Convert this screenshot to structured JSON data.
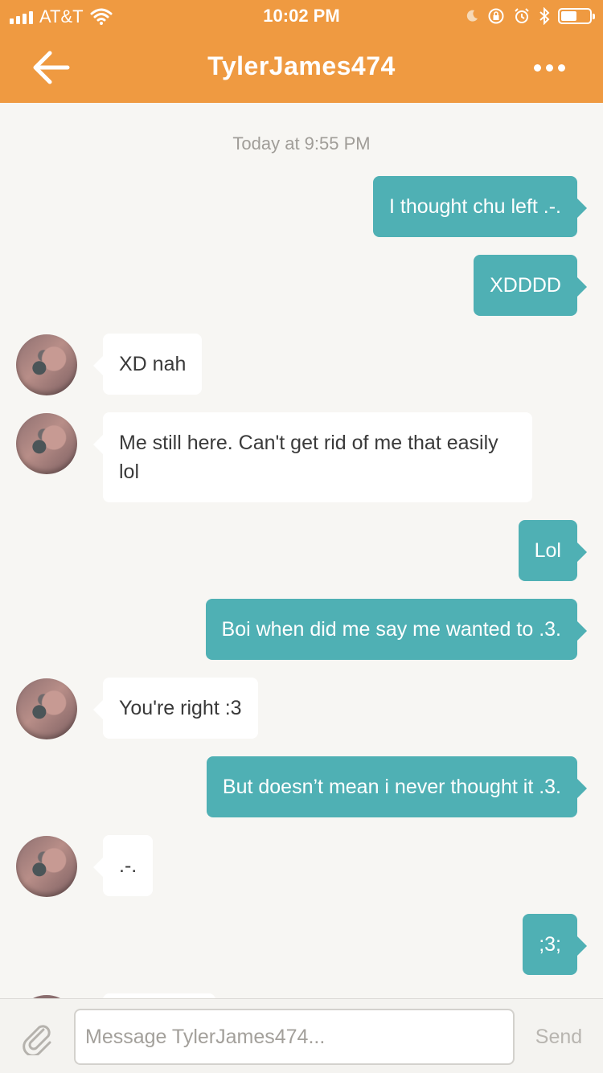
{
  "status_bar": {
    "carrier": "AT&T",
    "time": "10:02 PM",
    "battery_level": 0.55
  },
  "nav": {
    "back_icon": "arrow-left-icon",
    "title": "TylerJames474",
    "more_icon": "more-dots-icon"
  },
  "conversation": {
    "timestamp": "Today at 9:55 PM",
    "messages": [
      {
        "direction": "out",
        "text": "I thought chu left .-."
      },
      {
        "direction": "out",
        "text": "XDDDD"
      },
      {
        "direction": "in",
        "text": "XD nah"
      },
      {
        "direction": "in",
        "text": "Me still here. Can't get rid of me that easily lol"
      },
      {
        "direction": "out",
        "text": "Lol"
      },
      {
        "direction": "out",
        "text": "Boi when did me say me wanted to .3."
      },
      {
        "direction": "in",
        "text": "You're right :3"
      },
      {
        "direction": "out",
        "text": "But doesn’t mean i never thought it .3."
      },
      {
        "direction": "in",
        "text": ".-."
      },
      {
        "direction": "out",
        "text": ";3;"
      }
    ]
  },
  "composer": {
    "attach_icon": "paperclip-icon",
    "placeholder": "Message TylerJames474...",
    "send_label": "Send"
  },
  "colors": {
    "header": "#ef9a41",
    "outgoing_bubble": "#4fb0b4",
    "incoming_bubble": "#ffffff",
    "background": "#f7f6f3"
  }
}
